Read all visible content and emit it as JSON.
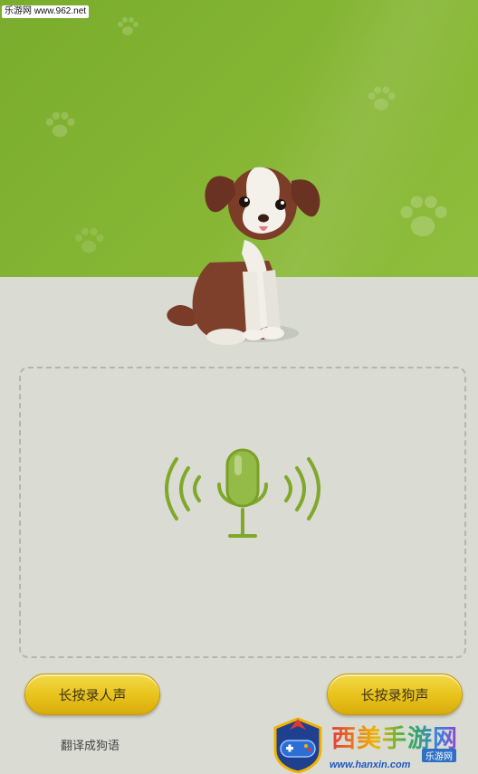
{
  "watermark_top": "乐游网 www.962.net",
  "buttons": {
    "record_human": "长按录人声",
    "record_dog": "长按录狗声"
  },
  "hint": "翻译成狗语",
  "logo": {
    "title": "西美手游网",
    "sub": "乐游网",
    "url": "www.hanxin.com"
  },
  "colors": {
    "header_green": "#7fb030",
    "mic_green": "#80a82a",
    "button_yellow": "#e8c21a"
  },
  "icons": [
    "paw-icon",
    "dog-illustration",
    "microphone-icon",
    "sound-wave-icon",
    "gamepad-icon"
  ]
}
